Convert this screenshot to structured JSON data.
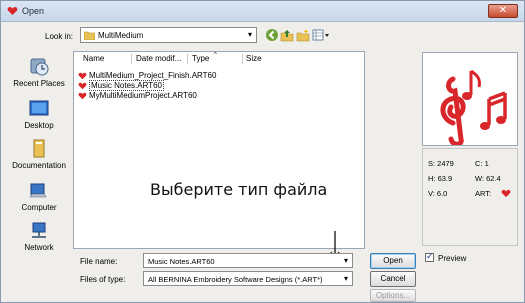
{
  "title": "Open",
  "look_in": {
    "label": "Look in:",
    "value": "MultiMedium"
  },
  "places": [
    {
      "label": "Recent Places",
      "icon": "recent-places-icon"
    },
    {
      "label": "Desktop",
      "icon": "desktop-icon"
    },
    {
      "label": "Documentation",
      "icon": "documentation-icon"
    },
    {
      "label": "Computer",
      "icon": "computer-icon"
    },
    {
      "label": "Network",
      "icon": "network-icon"
    }
  ],
  "columns": [
    "Name",
    "Date modif...",
    "Type",
    "Size"
  ],
  "files": [
    {
      "name": "MultiMedium_Project_Finish.ART60",
      "selected": false
    },
    {
      "name": "Music Notes.ART60",
      "selected": true
    },
    {
      "name": "MyMultiMediumProject.ART60",
      "selected": false
    }
  ],
  "overlay_text": "Выберите тип файла",
  "info": {
    "stitches": "S: 2479",
    "colors": "C: 1",
    "height": "H: 63.9",
    "width": "W: 62.4",
    "version": "V: 6.0",
    "art": "ART:"
  },
  "file_name": {
    "label": "File name:",
    "value": "Music Notes.ART60"
  },
  "files_of_type": {
    "label": "Files of type:",
    "value": "All BERNINA Embroidery Software Designs (*.ART*)"
  },
  "buttons": {
    "open": "Open",
    "cancel": "Cancel",
    "options": "Options..."
  },
  "preview_label": "Preview",
  "preview_checked": true,
  "colors": {
    "accent_red": "#d8262a",
    "title_bg": "#c7d7ea"
  }
}
